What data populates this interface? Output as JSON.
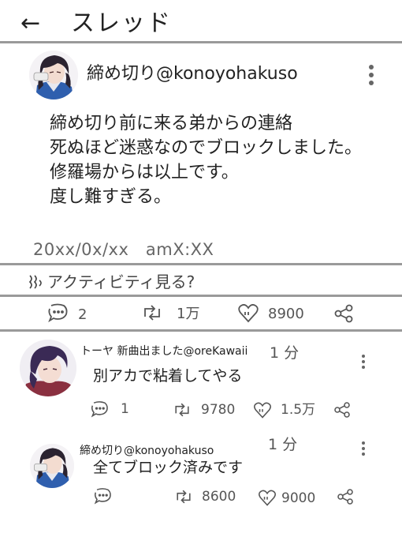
{
  "header": {
    "back_icon": "arrow-left-icon",
    "back_label": "←",
    "title": "スレッド"
  },
  "post": {
    "username": "締め切り@konoyohakuso",
    "lines": [
      "締め切り前に来る弟からの連絡",
      "死ぬほど迷惑なのでブロックしました。",
      "修羅場からは以上です。",
      "度し難すぎる。"
    ],
    "timestamp": "20xx/0x/xx　amX:XX",
    "activity": "アクティビティ見る?",
    "stats": {
      "reply_count": "2",
      "repost_count": "1万",
      "like_count": "8900"
    }
  },
  "replies": [
    {
      "username": "トーヤ 新曲出ました@oreKawaii",
      "time": "1 分",
      "text": "別アカで粘着してやる",
      "reply_count": "1",
      "repost_count": "9780",
      "like_count": "1.5万"
    },
    {
      "username": "締め切り@konoyohakuso",
      "time": "1 分",
      "text": "全てブロック済みです",
      "reply_count": "",
      "repost_count": "8600",
      "like_count": "9000"
    }
  ],
  "colors": {
    "divider": "#9a9a9a",
    "text": "#222222",
    "muted": "#666666",
    "hair_dark": "#2b2330",
    "hair_purple": "#3a2a55"
  }
}
